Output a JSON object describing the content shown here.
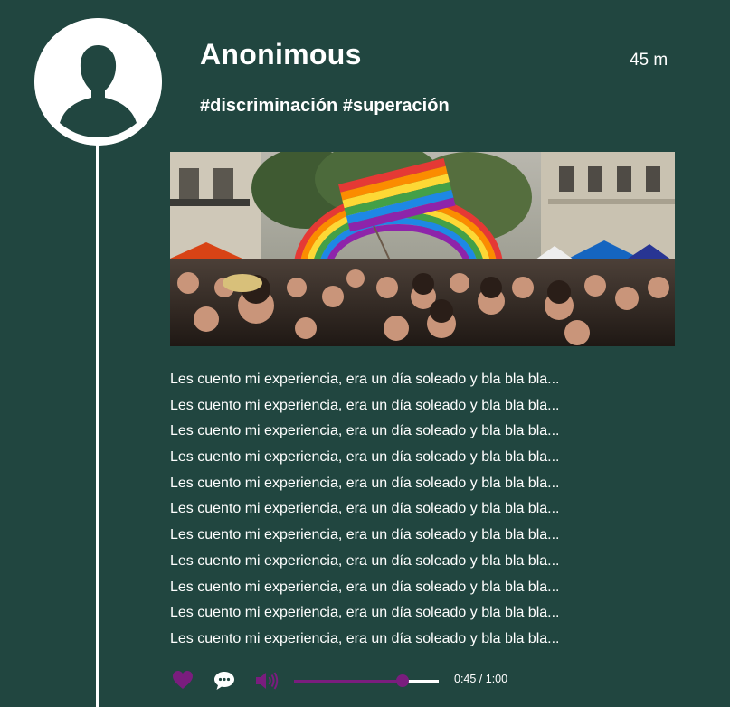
{
  "post": {
    "author": "Anonimous",
    "timestamp": "45 m",
    "tags": "#discriminación #superación",
    "photo_description_icon": "pride-crowd-photo",
    "story_lines": [
      "Les cuento mi experiencia, era un día soleado y bla bla bla...",
      "Les cuento mi experiencia, era un día soleado y bla bla bla...",
      "Les cuento mi experiencia, era un día soleado y bla bla bla...",
      "Les cuento mi experiencia, era un día soleado y bla bla bla...",
      "Les cuento mi experiencia, era un día soleado y bla bla bla...",
      "Les cuento mi experiencia, era un día soleado y bla bla bla...",
      "Les cuento mi experiencia, era un día soleado y bla bla bla...",
      "Les cuento mi experiencia, era un día soleado y bla bla bla...",
      "Les cuento mi experiencia, era un día soleado y bla bla bla...",
      "Les cuento mi experiencia, era un día soleado y bla bla bla...",
      "Les cuento mi experiencia, era un día soleado y bla bla bla..."
    ]
  },
  "player": {
    "time_display": "0:45 / 1:00",
    "progress": 0.75,
    "icons": [
      "heart-icon",
      "comment-icon",
      "volume-icon"
    ]
  },
  "colors": {
    "background": "#214640",
    "text": "#ffffff",
    "accent": "#7a1d7e"
  }
}
